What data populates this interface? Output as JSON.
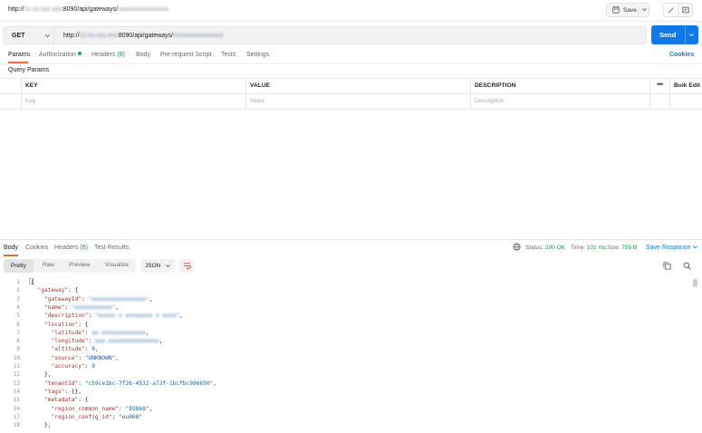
{
  "title_bar": {
    "url_prefix": "http://",
    "url_host_blur": "1x.xx.xxx.xxx",
    "url_port_path": ":8090/api/gateways/",
    "url_id_blur": "xxxxxxxxxxxxxxxx",
    "save_label": "Save",
    "icons": [
      "save-icon",
      "chevron-down-icon",
      "pencil-icon",
      "document-icon"
    ]
  },
  "request": {
    "method": "GET",
    "url_prefix": "http://",
    "url_host_blur": "1x.xx.xxx.xxx",
    "url_port_path": ":8090/api/gateways/",
    "url_id_blur": "xxxxxxxxxxxxxxxx",
    "send_label": "Send"
  },
  "request_tabs": {
    "params": "Params",
    "authorization": "Authorization",
    "headers": "Headers",
    "headers_count": "(8)",
    "body": "Body",
    "pre_request": "Pre-request Script",
    "tests": "Tests",
    "settings": "Settings",
    "cookies": "Cookies"
  },
  "query_params_label": "Query Params",
  "params_table": {
    "key_header": "KEY",
    "value_header": "VALUE",
    "description_header": "DESCRIPTION",
    "bulk_edit": "Bulk Edit",
    "key_placeholder": "Key",
    "value_placeholder": "Value",
    "description_placeholder": "Description"
  },
  "response_tabs": {
    "body": "Body",
    "cookies": "Cookies",
    "headers": "Headers",
    "headers_count": "(6)",
    "test_results": "Test Results"
  },
  "response_status": {
    "status_label": "Status:",
    "status_value": "200 OK",
    "time_label": "Time:",
    "time_value": "101 ms",
    "size_label": "Size:",
    "size_value": "755 B",
    "save_response": "Save Response"
  },
  "response_view": {
    "pretty": "Pretty",
    "raw": "Raw",
    "preview": "Preview",
    "visualize": "Visualize",
    "format": "JSON"
  },
  "code_lines": [
    {
      "n": "1",
      "indent": 0,
      "parts": [
        [
          "p",
          "{"
        ]
      ]
    },
    {
      "n": "2",
      "indent": 1,
      "parts": [
        [
          "k",
          "\"gateway\""
        ],
        [
          "p",
          ": {"
        ]
      ]
    },
    {
      "n": "3",
      "indent": 2,
      "parts": [
        [
          "k",
          "\"gatewayId\""
        ],
        [
          "p",
          ": "
        ],
        [
          "sb",
          "\"xxxxxxxxxxxxxxxx\""
        ],
        [
          "p",
          ","
        ]
      ]
    },
    {
      "n": "4",
      "indent": 2,
      "parts": [
        [
          "k",
          "\"name\""
        ],
        [
          "p",
          ": "
        ],
        [
          "sb",
          "\"xxxxxxxxxxx\""
        ],
        [
          "p",
          ","
        ]
      ]
    },
    {
      "n": "5",
      "indent": 2,
      "parts": [
        [
          "k",
          "\"description\""
        ],
        [
          "p",
          ": "
        ],
        [
          "sb",
          "\"xxxxx x xxxxxxxx x xxxx\""
        ],
        [
          "p",
          ","
        ]
      ]
    },
    {
      "n": "6",
      "indent": 2,
      "parts": [
        [
          "k",
          "\"location\""
        ],
        [
          "p",
          ": {"
        ]
      ]
    },
    {
      "n": "7",
      "indent": 3,
      "parts": [
        [
          "k",
          "\"latitude\""
        ],
        [
          "p",
          ": "
        ],
        [
          "nb",
          "xx.xxxxxxxxxxxxx"
        ],
        [
          "p",
          ","
        ]
      ]
    },
    {
      "n": "8",
      "indent": 3,
      "parts": [
        [
          "k",
          "\"longitude\""
        ],
        [
          "p",
          ": "
        ],
        [
          "nb",
          "xxx.xxxxxxxxxxxxxxx"
        ],
        [
          "p",
          ","
        ]
      ]
    },
    {
      "n": "9",
      "indent": 3,
      "parts": [
        [
          "k",
          "\"altitude\""
        ],
        [
          "p",
          ": "
        ],
        [
          "n",
          "0"
        ],
        [
          "p",
          ","
        ]
      ]
    },
    {
      "n": "10",
      "indent": 3,
      "parts": [
        [
          "k",
          "\"source\""
        ],
        [
          "p",
          ": "
        ],
        [
          "s",
          "\"UNKNOWN\""
        ],
        [
          "p",
          ","
        ]
      ]
    },
    {
      "n": "11",
      "indent": 3,
      "parts": [
        [
          "k",
          "\"accuracy\""
        ],
        [
          "p",
          ": "
        ],
        [
          "n",
          "0"
        ]
      ]
    },
    {
      "n": "12",
      "indent": 2,
      "parts": [
        [
          "p",
          "},"
        ]
      ]
    },
    {
      "n": "13",
      "indent": 2,
      "parts": [
        [
          "k",
          "\"tenantId\""
        ],
        [
          "p",
          ": "
        ],
        [
          "s",
          "\"c59ce1bc-7f26-4532-a73f-1bcfbc996650\""
        ],
        [
          "p",
          ","
        ]
      ]
    },
    {
      "n": "14",
      "indent": 2,
      "parts": [
        [
          "k",
          "\"tags\""
        ],
        [
          "p",
          ": {},"
        ]
      ]
    },
    {
      "n": "15",
      "indent": 2,
      "parts": [
        [
          "k",
          "\"metadata\""
        ],
        [
          "p",
          ": {"
        ]
      ]
    },
    {
      "n": "16",
      "indent": 3,
      "parts": [
        [
          "k",
          "\"region_common_name\""
        ],
        [
          "p",
          ": "
        ],
        [
          "s",
          "\"EU868\""
        ],
        [
          "p",
          ","
        ]
      ]
    },
    {
      "n": "17",
      "indent": 3,
      "parts": [
        [
          "k",
          "\"region_config_id\""
        ],
        [
          "p",
          ": "
        ],
        [
          "s",
          "\"eu868\""
        ]
      ]
    },
    {
      "n": "18",
      "indent": 2,
      "parts": [
        [
          "p",
          "},"
        ]
      ]
    }
  ],
  "colors": {
    "accent_orange": "#f26b3a",
    "primary_blue": "#0f79e7",
    "success_green": "#1b8f4a",
    "json_key": "#a3342a",
    "json_value": "#1b5e9e"
  }
}
